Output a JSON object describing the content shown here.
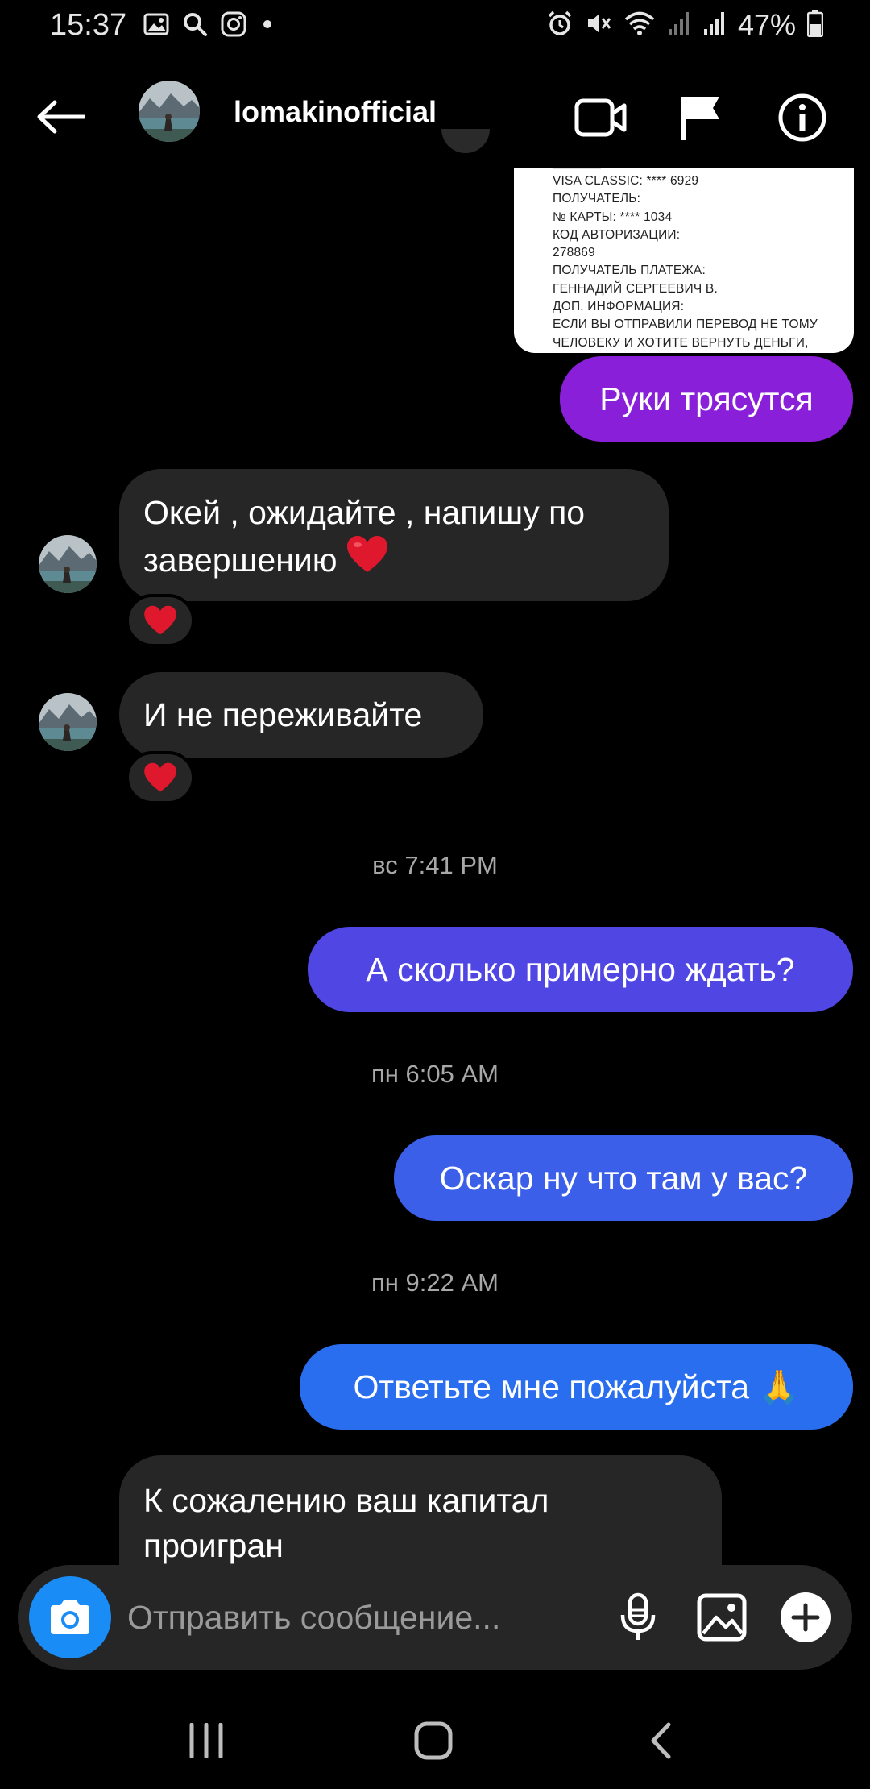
{
  "status_bar": {
    "time": "15:37",
    "battery": "47%",
    "icons_left": [
      "gallery-icon",
      "search-icon",
      "instagram-icon",
      "dot-icon"
    ],
    "icons_right": [
      "alarm-icon",
      "mute-icon",
      "wifi-icon",
      "signal-icon",
      "signal-icon",
      "battery-icon"
    ]
  },
  "header": {
    "username": "lomakinofficial",
    "actions": [
      "video-call-icon",
      "flag-icon",
      "info-icon"
    ]
  },
  "receipt_lines": [
    "VISA CLASSIC: **** 6929",
    "ПОЛУЧАТЕЛЬ:",
    "№ КАРТЫ: **** 1034",
    "КОД АВТОРИЗАЦИИ:",
    "278869",
    "ПОЛУЧАТЕЛЬ ПЛАТЕЖА:",
    "ГЕННАДИЙ СЕРГЕЕВИЧ В.",
    "ДОП. ИНФОРМАЦИЯ:",
    "ЕСЛИ ВЫ ОТПРАВИЛИ ПЕРЕВОД НЕ ТОМУ",
    "ЧЕЛОВЕКУ И ХОТИТЕ ВЕРНУТЬ ДЕНЬГИ,"
  ],
  "messages": {
    "out1": "Руки трясутся",
    "in1_line1": "Окей , ожидайте , напишу по",
    "in1_line2": "завершению",
    "in2": "И не переживайте",
    "ts1": "вс 7:41 PM",
    "out2": "А сколько примерно ждать?",
    "ts2": "пн 6:05 AM",
    "out3": "Оскар ну что там у вас?",
    "ts3": "пн 9:22 AM",
    "out4": "Ответьте мне пожалуйста 🙏",
    "in3_line1": "К сожалению ваш капитал",
    "in3_line2": "проигран"
  },
  "colors": {
    "bubble_out1": "#8a1fd9",
    "bubble_out2": "#5046e3",
    "bubble_out3": "#3b5fe8",
    "bubble_out4": "#2a6ef0",
    "bubble_in": "#262626",
    "camera": "#1a8cf5"
  },
  "composer": {
    "placeholder": "Отправить сообщение..."
  }
}
